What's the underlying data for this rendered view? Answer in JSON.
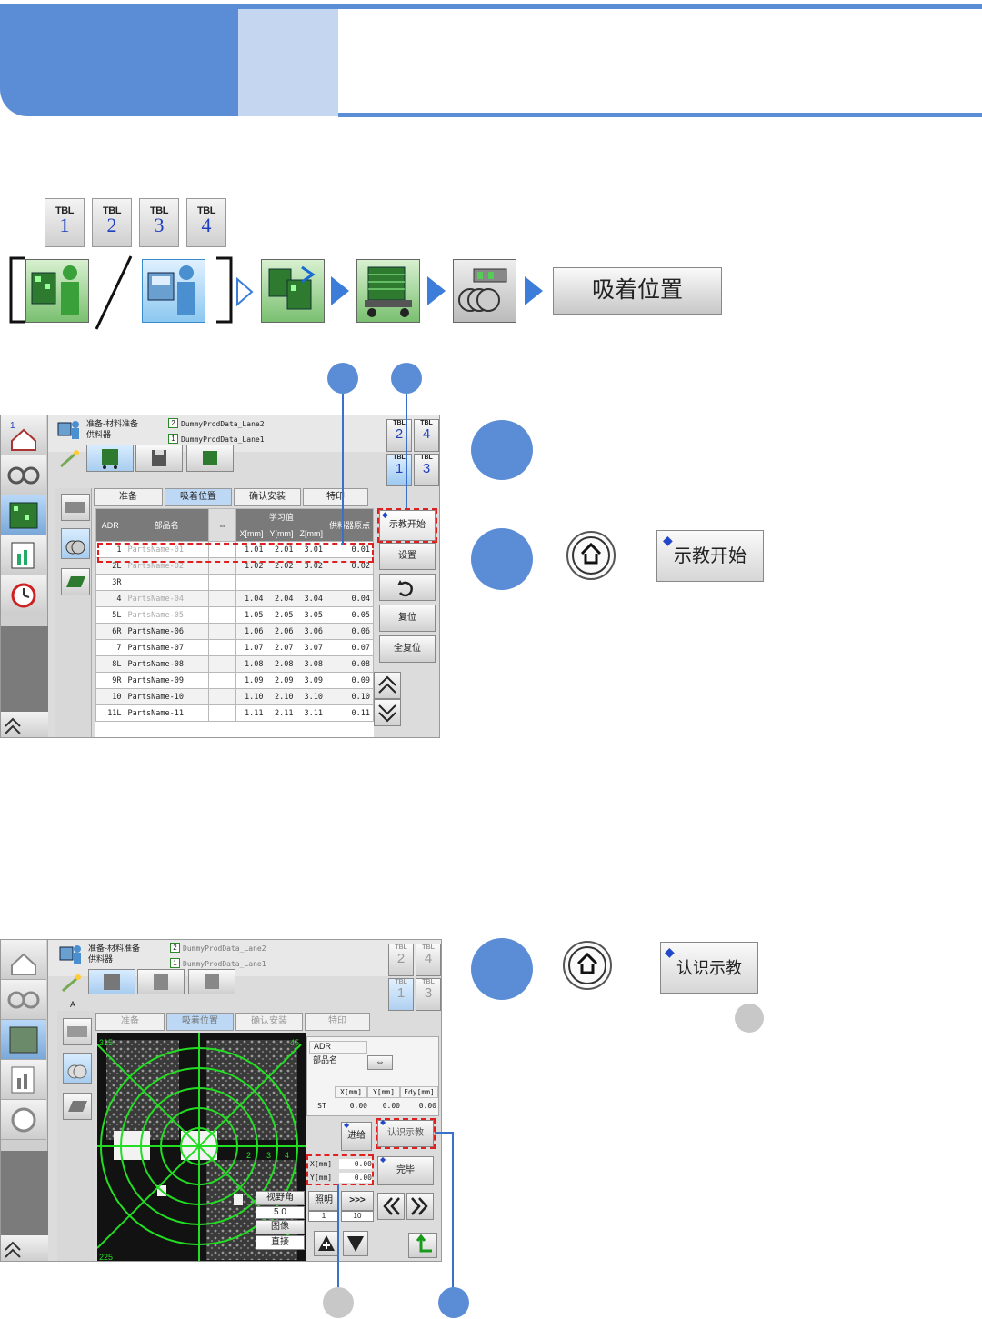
{
  "tbl_keys": [
    {
      "label": "TBL",
      "num": "1"
    },
    {
      "label": "TBL",
      "num": "2"
    },
    {
      "label": "TBL",
      "num": "3"
    },
    {
      "label": "TBL",
      "num": "4"
    }
  ],
  "nav_button": "吸着位置",
  "screen1": {
    "header_line1": "准备-材料准备",
    "header_line2": "供料器",
    "prod_lane2_num": "2",
    "prod_lane2": "DummyProdData_Lane2",
    "prod_lane1_num": "1",
    "prod_lane1": "DummyProdData_Lane1",
    "tabs": [
      "准备",
      "吸着位置",
      "确认安装",
      "特印"
    ],
    "table_headers": {
      "adr": "ADR",
      "parts": "部品名",
      "swap": "⇔",
      "learned": "学习值",
      "x": "X[mm]",
      "y": "Y[mm]",
      "z": "Z[mm]",
      "feeder_origin": "供料器原点"
    },
    "rows": [
      {
        "adr": "1",
        "name": "PartsName-01",
        "x": "1.01",
        "y": "2.01",
        "z": "3.01",
        "o": "0.01",
        "dim": true
      },
      {
        "adr": "2L",
        "name": "PartsName-02",
        "x": "1.02",
        "y": "2.02",
        "z": "3.02",
        "o": "0.02",
        "dim": true
      },
      {
        "adr": "3R",
        "name": "",
        "x": "",
        "y": "",
        "z": "",
        "o": "",
        "dim": false
      },
      {
        "adr": "4",
        "name": "PartsName-04",
        "x": "1.04",
        "y": "2.04",
        "z": "3.04",
        "o": "0.04",
        "dim": true
      },
      {
        "adr": "5L",
        "name": "PartsName-05",
        "x": "1.05",
        "y": "2.05",
        "z": "3.05",
        "o": "0.05",
        "dim": true
      },
      {
        "adr": "6R",
        "name": "PartsName-06",
        "x": "1.06",
        "y": "2.06",
        "z": "3.06",
        "o": "0.06",
        "dim": false
      },
      {
        "adr": "7",
        "name": "PartsName-07",
        "x": "1.07",
        "y": "2.07",
        "z": "3.07",
        "o": "0.07",
        "dim": false
      },
      {
        "adr": "8L",
        "name": "PartsName-08",
        "x": "1.08",
        "y": "2.08",
        "z": "3.08",
        "o": "0.08",
        "dim": false
      },
      {
        "adr": "9R",
        "name": "PartsName-09",
        "x": "1.09",
        "y": "2.09",
        "z": "3.09",
        "o": "0.09",
        "dim": false
      },
      {
        "adr": "10",
        "name": "PartsName-10",
        "x": "1.10",
        "y": "2.10",
        "z": "3.10",
        "o": "0.10",
        "dim": false
      },
      {
        "adr": "11L",
        "name": "PartsName-11",
        "x": "1.11",
        "y": "2.11",
        "z": "3.11",
        "o": "0.11",
        "dim": false
      }
    ],
    "teach_start": "示教开始",
    "setting": "设置",
    "reset": "复位",
    "reset_all": "全复位",
    "tbl_small": [
      {
        "label": "TBL",
        "num": "2"
      },
      {
        "label": "TBL",
        "num": "4"
      },
      {
        "label": "TBL",
        "num": "1"
      },
      {
        "label": "TBL",
        "num": "3"
      }
    ]
  },
  "step_button_1": "示教开始",
  "screen2": {
    "header_line1": "准备-材料准备",
    "header_line2": "供料器",
    "prod_lane2_num": "2",
    "prod_lane2": "DummyProdData_Lane2",
    "prod_lane1_num": "1",
    "prod_lane1": "DummyProdData_Lane1",
    "sub_label": "A",
    "tabs": [
      "准备",
      "吸着位置",
      "确认安装",
      "特印"
    ],
    "cam_labels": {
      "tl": "315",
      "tr": "45",
      "bl": "225",
      "n2": "2",
      "n3": "3",
      "n4": "4"
    },
    "info": {
      "adr": "ADR",
      "parts": "部品名",
      "swap": "⇔",
      "x": "X[mm]",
      "y": "Y[mm]",
      "fdy": "Fdy[mm]",
      "st": "ST",
      "st_x": "0.00",
      "st_y": "0.00",
      "st_fdy": "0.00"
    },
    "feed": "进给",
    "recog_teach": "认识示教",
    "finish": "完毕",
    "xy": {
      "x_label": "X[mm]",
      "x_val": "0.00",
      "y_label": "Y[mm]",
      "y_val": "0.00"
    },
    "view_angle": "视野角",
    "view_angle_val": "5.0",
    "image": "图像",
    "image_val": "直接",
    "light": "照明",
    "light_val": "1",
    "step_val": "10",
    "ff": ">>>",
    "tbl_small": [
      {
        "label": "TBL",
        "num": "2"
      },
      {
        "label": "TBL",
        "num": "4"
      },
      {
        "label": "TBL",
        "num": "1"
      },
      {
        "label": "TBL",
        "num": "3"
      }
    ]
  },
  "step_button_2": "认识示教"
}
